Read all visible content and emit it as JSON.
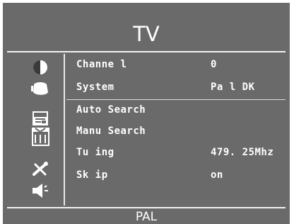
{
  "title": "TV",
  "footer": "PAL",
  "sidebar": {
    "icons": [
      "contrast-icon",
      "sound-icon",
      "image-icon",
      "tv-icon",
      "setup-tools-icon",
      "speaker-icon"
    ]
  },
  "menu": {
    "items": [
      {
        "label": "Channe l",
        "value": "0"
      },
      {
        "label": "System",
        "value": "Pa l DK"
      },
      {
        "label": "Auto Search",
        "value": ""
      },
      {
        "label": "Manu Search",
        "value": ""
      },
      {
        "label": "Tu ing",
        "value": "479. 25Mhz"
      },
      {
        "label": "Sk ip",
        "value": "on"
      }
    ]
  },
  "colors": {
    "background": "#6a6a6a",
    "text": "#ffffff",
    "lines": "#f2f2f2"
  }
}
